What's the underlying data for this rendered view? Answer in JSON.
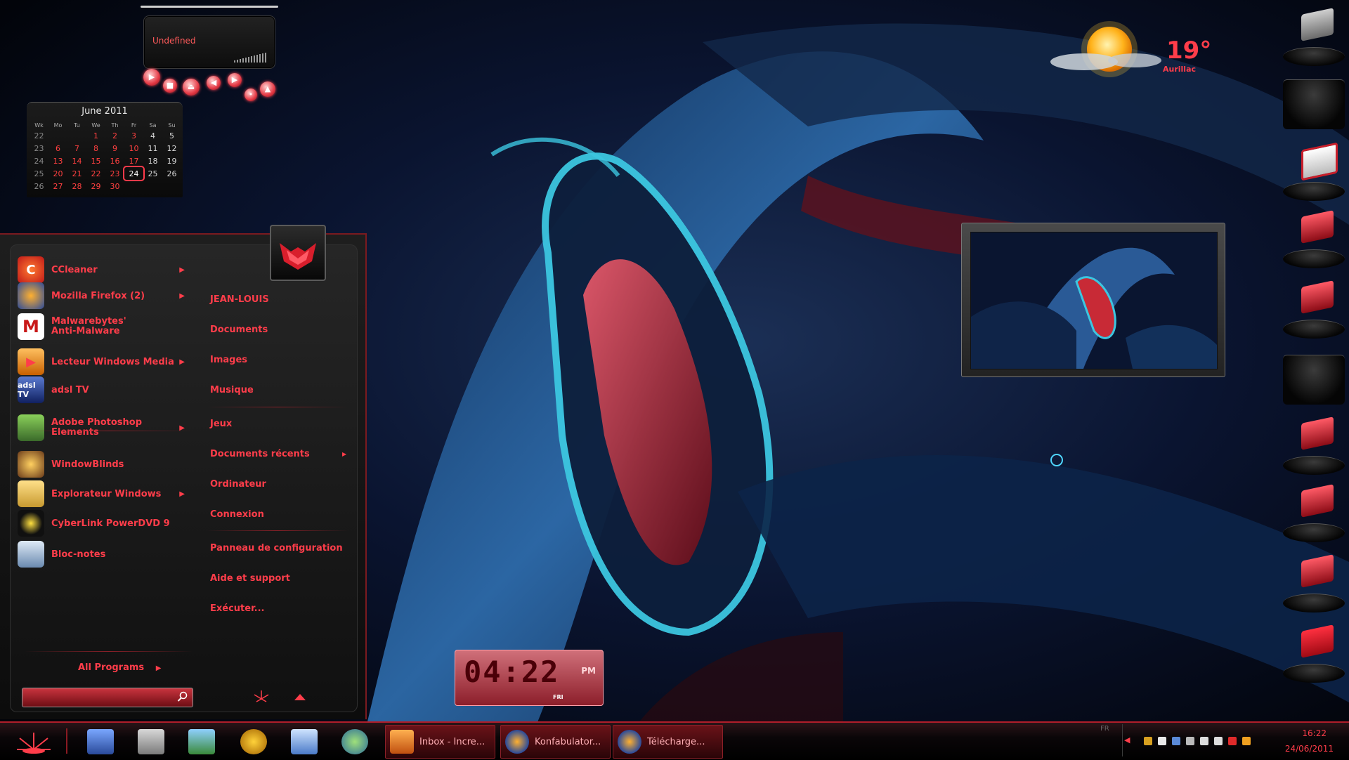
{
  "media": {
    "status": "Undefined"
  },
  "calendar": {
    "title": "June 2011",
    "headers": [
      "Wk",
      "Mo",
      "Tu",
      "We",
      "Th",
      "Fr",
      "Sa",
      "Su"
    ],
    "weeks": [
      [
        "22",
        "",
        "",
        "1",
        "2",
        "3",
        "4",
        "5"
      ],
      [
        "23",
        "6",
        "7",
        "8",
        "9",
        "10",
        "11",
        "12"
      ],
      [
        "24",
        "13",
        "14",
        "15",
        "16",
        "17",
        "18",
        "19"
      ],
      [
        "25",
        "20",
        "21",
        "22",
        "23",
        "24",
        "25",
        "26"
      ],
      [
        "26",
        "27",
        "28",
        "29",
        "30",
        "",
        "",
        ""
      ]
    ],
    "today": "24"
  },
  "start_menu": {
    "programs": [
      {
        "label": "CCleaner",
        "icon": "ccleaner-icon",
        "submenu": true
      },
      {
        "label": "Mozilla Firefox (2)",
        "icon": "firefox-icon",
        "submenu": true
      },
      {
        "label": "Malwarebytes' Anti-Malware",
        "icon": "malwarebytes-icon",
        "submenu": false
      },
      {
        "label": "Lecteur Windows Media",
        "icon": "media-player-icon",
        "submenu": true
      },
      {
        "label": "adsl TV",
        "icon": "adsl-tv-icon",
        "submenu": false
      },
      {
        "label": "Adobe Photoshop Elements",
        "icon": "photoshop-icon",
        "submenu": true
      },
      {
        "label": "WindowBlinds",
        "icon": "windowblinds-icon",
        "submenu": false
      },
      {
        "label": "Explorateur Windows",
        "icon": "folder-icon",
        "submenu": true
      },
      {
        "label": "CyberLink PowerDVD 9",
        "icon": "powerdvd-icon",
        "submenu": false
      },
      {
        "label": "Bloc-notes",
        "icon": "notepad-icon",
        "submenu": false
      }
    ],
    "all_programs": "All Programs",
    "adsl_icon_text": "adsl TV",
    "places": [
      "JEAN-LOUIS",
      "Documents",
      "Images",
      "Musique",
      "Jeux",
      "Documents récents",
      "Ordinateur",
      "Connexion",
      "Panneau de configuration",
      "Aide et support",
      "Exécuter..."
    ]
  },
  "clock": {
    "time": "04:22",
    "ampm": "PM",
    "day": "FRI"
  },
  "weather": {
    "temp": "19°",
    "city": "Aurillac"
  },
  "taskbar": {
    "tasks": [
      {
        "label": "Inbox - Incre...",
        "icon": "mail-icon"
      },
      {
        "label": "Konfabulator...",
        "icon": "firefox-icon"
      },
      {
        "label": "Télécharge...",
        "icon": "firefox-icon"
      }
    ],
    "language": "FR",
    "time": "16:22",
    "date": "24/06/2011"
  },
  "colors": {
    "accent": "#ff3d4a",
    "taskbar_border": "#b01e2a"
  }
}
